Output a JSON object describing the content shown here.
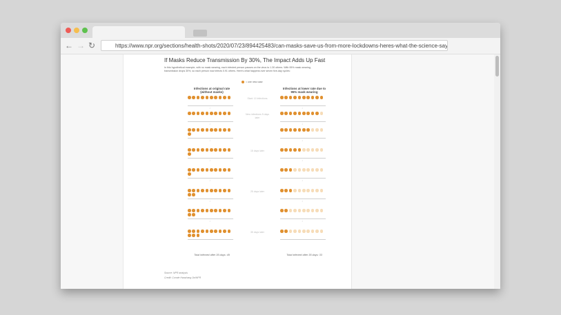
{
  "browser": {
    "url": "https://www.npr.org/sections/health-shots/2020/07/23/894425483/can-masks-save-us-from-more-lockdowns-heres-what-the-science-says",
    "icons": [
      "back-arrow-icon",
      "forward-arrow-icon",
      "reload-icon"
    ],
    "colors": {
      "close": "#ee5b56",
      "minimize": "#f5be4f",
      "maximize": "#5ec14e"
    }
  },
  "graphic": {
    "title": "If Masks Reduce Transmission By 30%, The Impact Adds Up Fast",
    "subtitle": "In this hypothetical example, with no mask wearing, each infected person passes on the virus to 1.30 others. With 95% mask wearing, transmission drops 30%, so each person now infects 0.91 others. Here's what happens over seven five-day cycles:",
    "legend_label": "= one new case",
    "left_heading": "Infections at original rate (without masks)",
    "right_heading": "Infections at lower rate due to 95% mask wearing",
    "mid_labels": [
      "Start: 10 infections",
      "New infections 5 days later",
      "15 days later",
      "25 days later",
      "35 days later"
    ],
    "left_total": "Total infected after 35 days: 49",
    "right_total": "Total infected after 35 days: 33",
    "source": "Source: NPR analysis",
    "credit": "Credit: Connie Hanzhang Jin/NPR",
    "colors": {
      "case": "#e0902f",
      "faded": "#f6dcb8"
    }
  },
  "chart_data": {
    "type": "table",
    "series": [
      {
        "name": "Infections at original rate (without masks)",
        "values": [
          10,
          10,
          11,
          11,
          11,
          12,
          12,
          13
        ]
      },
      {
        "name": "Infections at lower rate due to 95% mask wearing",
        "values": [
          10,
          9,
          7,
          5,
          3,
          3,
          2,
          2
        ]
      }
    ],
    "totals": [
      49,
      33
    ]
  }
}
